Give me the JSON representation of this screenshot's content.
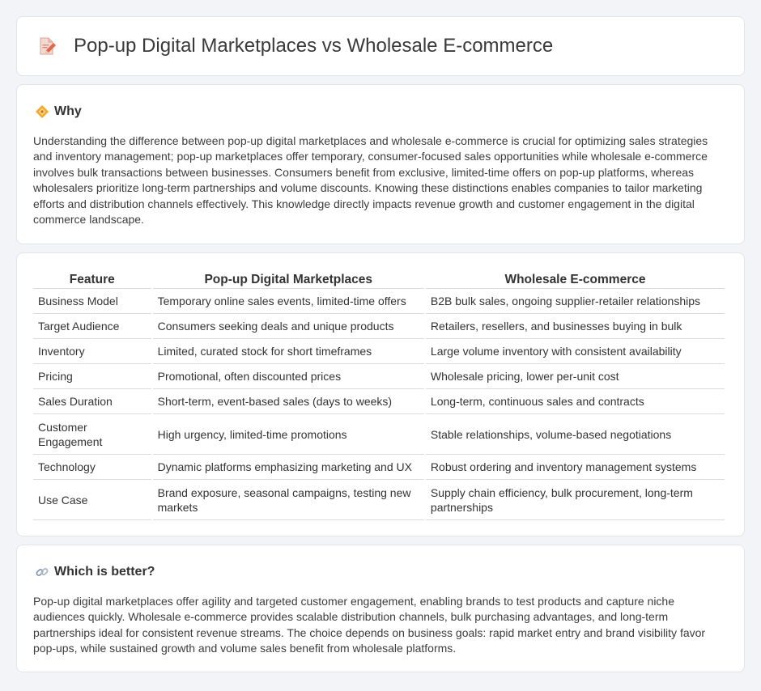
{
  "header": {
    "title": "Pop-up Digital Marketplaces vs Wholesale E-commerce",
    "icon": "document-pencil-icon"
  },
  "why": {
    "heading": "Why",
    "icon": "diamond-sparkle-icon",
    "text": "Understanding the difference between pop-up digital marketplaces and wholesale e-commerce is crucial for optimizing sales strategies and inventory management; pop-up marketplaces offer temporary, consumer-focused sales opportunities while wholesale e-commerce involves bulk transactions between businesses. Consumers benefit from exclusive, limited-time offers on pop-up platforms, whereas wholesalers prioritize long-term partnerships and volume discounts. Knowing these distinctions enables companies to tailor marketing efforts and distribution channels effectively. This knowledge directly impacts revenue growth and customer engagement in the digital commerce landscape."
  },
  "table": {
    "headers": [
      "Feature",
      "Pop-up Digital Marketplaces",
      "Wholesale E-commerce"
    ],
    "rows": [
      [
        "Business Model",
        "Temporary online sales events, limited-time offers",
        "B2B bulk sales, ongoing supplier-retailer relationships"
      ],
      [
        "Target Audience",
        "Consumers seeking deals and unique products",
        "Retailers, resellers, and businesses buying in bulk"
      ],
      [
        "Inventory",
        "Limited, curated stock for short timeframes",
        "Large volume inventory with consistent availability"
      ],
      [
        "Pricing",
        "Promotional, often discounted prices",
        "Wholesale pricing, lower per-unit cost"
      ],
      [
        "Sales Duration",
        "Short-term, event-based sales (days to weeks)",
        "Long-term, continuous sales and contracts"
      ],
      [
        "Customer Engagement",
        "High urgency, limited-time promotions",
        "Stable relationships, volume-based negotiations"
      ],
      [
        "Technology",
        "Dynamic platforms emphasizing marketing and UX",
        "Robust ordering and inventory management systems"
      ],
      [
        "Use Case",
        "Brand exposure, seasonal campaigns, testing new markets",
        "Supply chain efficiency, bulk procurement, long-term partnerships"
      ]
    ]
  },
  "better": {
    "heading": "Which is better?",
    "icon": "link-icon",
    "text": "Pop-up digital marketplaces offer agility and targeted customer engagement, enabling brands to test products and capture niche audiences quickly. Wholesale e-commerce provides scalable distribution channels, bulk purchasing advantages, and long-term partnerships ideal for consistent revenue streams. The choice depends on business goals: rapid market entry and brand visibility favor pop-ups, while sustained growth and volume sales benefit from wholesale platforms."
  }
}
